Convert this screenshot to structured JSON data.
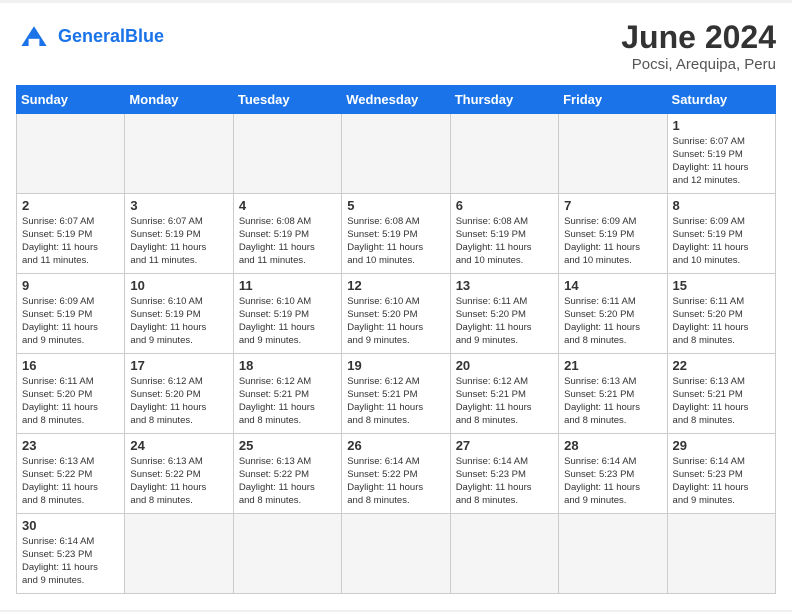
{
  "header": {
    "logo_general": "General",
    "logo_blue": "Blue",
    "title": "June 2024",
    "subtitle": "Pocsi, Arequipa, Peru"
  },
  "weekdays": [
    "Sunday",
    "Monday",
    "Tuesday",
    "Wednesday",
    "Thursday",
    "Friday",
    "Saturday"
  ],
  "weeks": [
    [
      {
        "day": "",
        "info": ""
      },
      {
        "day": "",
        "info": ""
      },
      {
        "day": "",
        "info": ""
      },
      {
        "day": "",
        "info": ""
      },
      {
        "day": "",
        "info": ""
      },
      {
        "day": "",
        "info": ""
      },
      {
        "day": "1",
        "info": "Sunrise: 6:07 AM\nSunset: 5:19 PM\nDaylight: 11 hours\nand 12 minutes."
      }
    ],
    [
      {
        "day": "2",
        "info": "Sunrise: 6:07 AM\nSunset: 5:19 PM\nDaylight: 11 hours\nand 11 minutes."
      },
      {
        "day": "3",
        "info": "Sunrise: 6:07 AM\nSunset: 5:19 PM\nDaylight: 11 hours\nand 11 minutes."
      },
      {
        "day": "4",
        "info": "Sunrise: 6:08 AM\nSunset: 5:19 PM\nDaylight: 11 hours\nand 11 minutes."
      },
      {
        "day": "5",
        "info": "Sunrise: 6:08 AM\nSunset: 5:19 PM\nDaylight: 11 hours\nand 10 minutes."
      },
      {
        "day": "6",
        "info": "Sunrise: 6:08 AM\nSunset: 5:19 PM\nDaylight: 11 hours\nand 10 minutes."
      },
      {
        "day": "7",
        "info": "Sunrise: 6:09 AM\nSunset: 5:19 PM\nDaylight: 11 hours\nand 10 minutes."
      },
      {
        "day": "8",
        "info": "Sunrise: 6:09 AM\nSunset: 5:19 PM\nDaylight: 11 hours\nand 10 minutes."
      }
    ],
    [
      {
        "day": "9",
        "info": "Sunrise: 6:09 AM\nSunset: 5:19 PM\nDaylight: 11 hours\nand 9 minutes."
      },
      {
        "day": "10",
        "info": "Sunrise: 6:10 AM\nSunset: 5:19 PM\nDaylight: 11 hours\nand 9 minutes."
      },
      {
        "day": "11",
        "info": "Sunrise: 6:10 AM\nSunset: 5:19 PM\nDaylight: 11 hours\nand 9 minutes."
      },
      {
        "day": "12",
        "info": "Sunrise: 6:10 AM\nSunset: 5:20 PM\nDaylight: 11 hours\nand 9 minutes."
      },
      {
        "day": "13",
        "info": "Sunrise: 6:11 AM\nSunset: 5:20 PM\nDaylight: 11 hours\nand 9 minutes."
      },
      {
        "day": "14",
        "info": "Sunrise: 6:11 AM\nSunset: 5:20 PM\nDaylight: 11 hours\nand 8 minutes."
      },
      {
        "day": "15",
        "info": "Sunrise: 6:11 AM\nSunset: 5:20 PM\nDaylight: 11 hours\nand 8 minutes."
      }
    ],
    [
      {
        "day": "16",
        "info": "Sunrise: 6:11 AM\nSunset: 5:20 PM\nDaylight: 11 hours\nand 8 minutes."
      },
      {
        "day": "17",
        "info": "Sunrise: 6:12 AM\nSunset: 5:20 PM\nDaylight: 11 hours\nand 8 minutes."
      },
      {
        "day": "18",
        "info": "Sunrise: 6:12 AM\nSunset: 5:21 PM\nDaylight: 11 hours\nand 8 minutes."
      },
      {
        "day": "19",
        "info": "Sunrise: 6:12 AM\nSunset: 5:21 PM\nDaylight: 11 hours\nand 8 minutes."
      },
      {
        "day": "20",
        "info": "Sunrise: 6:12 AM\nSunset: 5:21 PM\nDaylight: 11 hours\nand 8 minutes."
      },
      {
        "day": "21",
        "info": "Sunrise: 6:13 AM\nSunset: 5:21 PM\nDaylight: 11 hours\nand 8 minutes."
      },
      {
        "day": "22",
        "info": "Sunrise: 6:13 AM\nSunset: 5:21 PM\nDaylight: 11 hours\nand 8 minutes."
      }
    ],
    [
      {
        "day": "23",
        "info": "Sunrise: 6:13 AM\nSunset: 5:22 PM\nDaylight: 11 hours\nand 8 minutes."
      },
      {
        "day": "24",
        "info": "Sunrise: 6:13 AM\nSunset: 5:22 PM\nDaylight: 11 hours\nand 8 minutes."
      },
      {
        "day": "25",
        "info": "Sunrise: 6:13 AM\nSunset: 5:22 PM\nDaylight: 11 hours\nand 8 minutes."
      },
      {
        "day": "26",
        "info": "Sunrise: 6:14 AM\nSunset: 5:22 PM\nDaylight: 11 hours\nand 8 minutes."
      },
      {
        "day": "27",
        "info": "Sunrise: 6:14 AM\nSunset: 5:23 PM\nDaylight: 11 hours\nand 8 minutes."
      },
      {
        "day": "28",
        "info": "Sunrise: 6:14 AM\nSunset: 5:23 PM\nDaylight: 11 hours\nand 9 minutes."
      },
      {
        "day": "29",
        "info": "Sunrise: 6:14 AM\nSunset: 5:23 PM\nDaylight: 11 hours\nand 9 minutes."
      }
    ],
    [
      {
        "day": "30",
        "info": "Sunrise: 6:14 AM\nSunset: 5:23 PM\nDaylight: 11 hours\nand 9 minutes."
      },
      {
        "day": "",
        "info": ""
      },
      {
        "day": "",
        "info": ""
      },
      {
        "day": "",
        "info": ""
      },
      {
        "day": "",
        "info": ""
      },
      {
        "day": "",
        "info": ""
      },
      {
        "day": "",
        "info": ""
      }
    ]
  ]
}
